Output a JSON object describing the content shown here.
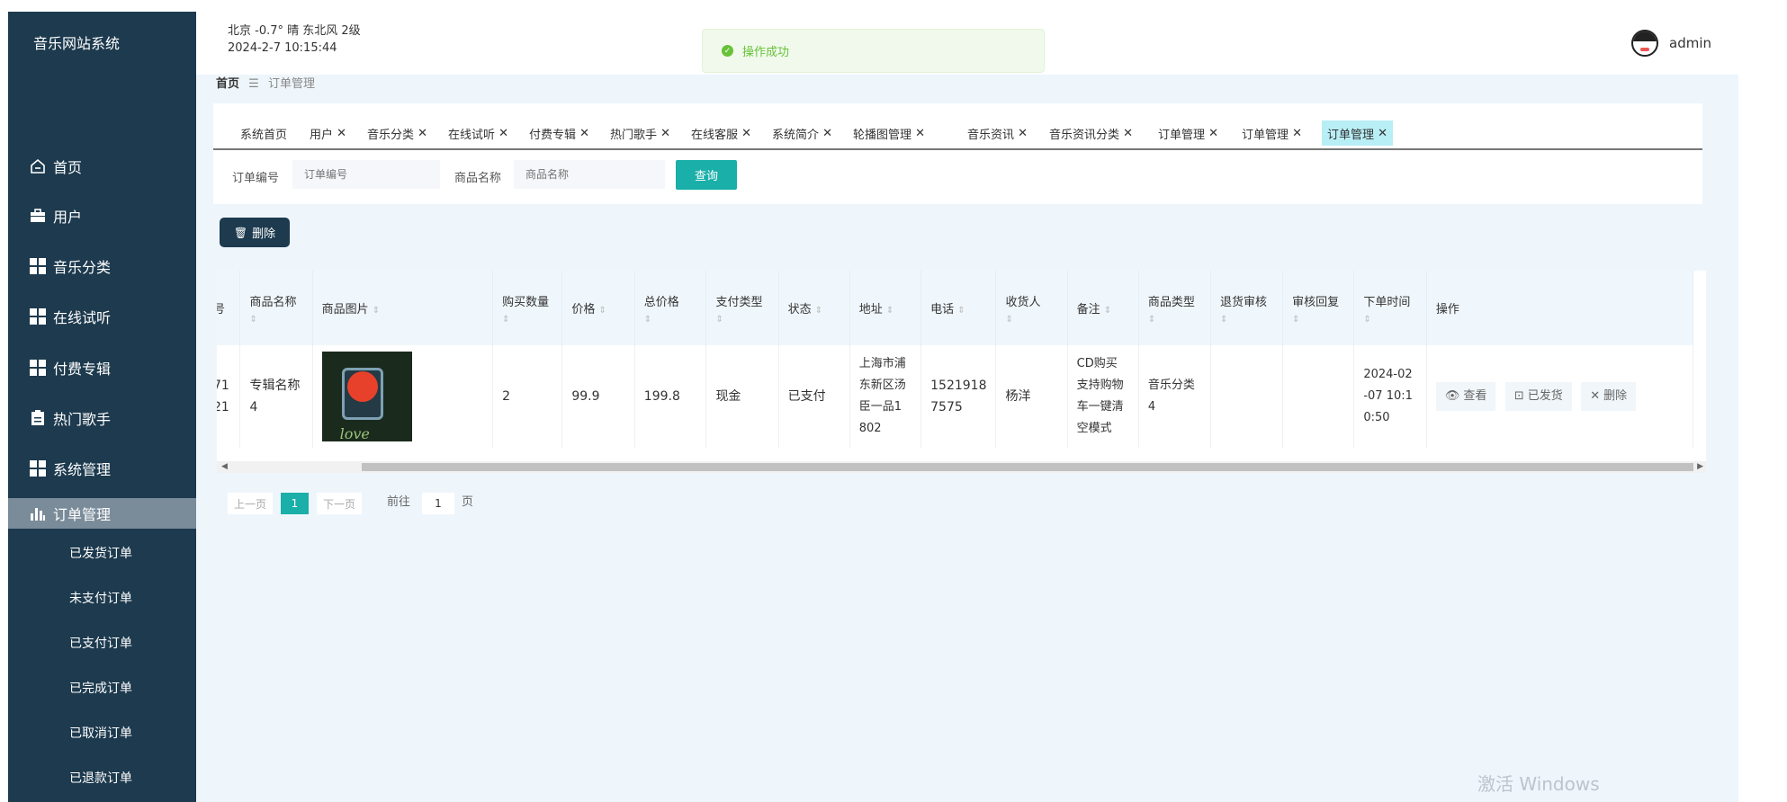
{
  "sidebar": {
    "brand": "音乐网站系统",
    "items": [
      {
        "label": "首页"
      },
      {
        "label": "用户"
      },
      {
        "label": "音乐分类"
      },
      {
        "label": "在线试听"
      },
      {
        "label": "付费专辑"
      },
      {
        "label": "热门歌手"
      },
      {
        "label": "系统管理"
      },
      {
        "label": "订单管理"
      }
    ],
    "sub_items": [
      "已发货订单",
      "未支付订单",
      "已支付订单",
      "已完成订单",
      "已取消订单",
      "已退款订单"
    ]
  },
  "header": {
    "weather": "北京  -0.7°  晴  东北风  2级",
    "datetime": "2024-2-7 10:15:44",
    "toast": "操作成功",
    "username": "admin"
  },
  "breadcrumb": {
    "home": "首页",
    "sep": "☰",
    "current": "订单管理"
  },
  "tabs": [
    "系统首页",
    "用户",
    "音乐分类",
    "在线试听",
    "付费专辑",
    "热门歌手",
    "在线客服",
    "系统简介",
    "轮播图管理",
    "音乐资讯",
    "音乐资讯分类",
    "订单管理",
    "订单管理",
    "订单管理"
  ],
  "search": {
    "order_label": "订单编号",
    "order_placeholder": "订单编号",
    "product_label": "商品名称",
    "product_placeholder": "商品名称",
    "query_button": "查询"
  },
  "toolbar": {
    "delete_button": "删除"
  },
  "table": {
    "headers": [
      "号",
      "商品名称",
      "商品图片",
      "购买数量",
      "价格",
      "总价格",
      "支付类型",
      "状态",
      "地址",
      "电话",
      "收货人",
      "备注",
      "商品类型",
      "退货审核",
      "审核回复",
      "下单时间",
      "操作"
    ],
    "row": {
      "order_no": "71\n21",
      "name": "专辑名称\n4",
      "quantity": "2",
      "price": "99.9",
      "total": "199.8",
      "pay_type": "现金",
      "status": "已支付",
      "address": "上海市浦\n东新区汤\n臣一品1\n802",
      "phone": "1521918\n7575",
      "receiver": "杨洋",
      "remark": "CD购买\n支持购物\n车一键清\n空模式",
      "product_type": "音乐分类\n4",
      "return_review": "",
      "review_reply": "",
      "order_time": "2024-02\n-07 10:1\n0:50",
      "image_text": "love",
      "actions": {
        "view": "查看",
        "ship": "已发货",
        "delete": "删除"
      }
    }
  },
  "pagination": {
    "prev": "上一页",
    "current": "1",
    "next": "下一页",
    "goto_label": "前往",
    "goto_value": "1",
    "page_suffix": "页"
  },
  "watermark": "激活 Windows",
  "colors": {
    "sidebar": "#1d3a4e",
    "accent": "#1aafa9",
    "active_menu": "#7a8b99",
    "active_tab": "#b8eef5",
    "success": "#67c23a"
  }
}
